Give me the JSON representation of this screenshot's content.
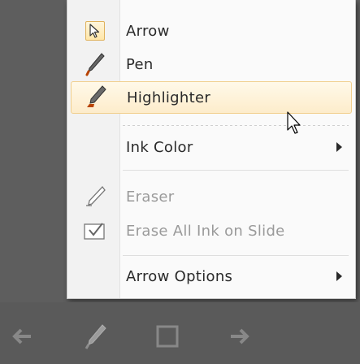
{
  "menu": {
    "items": [
      {
        "label": "Arrow",
        "icon": "arrow-pointer-icon",
        "checked": true,
        "enabled": true
      },
      {
        "label": "Pen",
        "icon": "pen-icon",
        "enabled": true
      },
      {
        "label": "Highlighter",
        "icon": "highlighter-icon",
        "enabled": true,
        "hovered": true
      },
      {
        "label": "Ink Color",
        "enabled": true,
        "submenu": true
      },
      {
        "label": "Eraser",
        "icon": "eraser-icon",
        "enabled": false
      },
      {
        "label": "Erase All Ink on Slide",
        "icon": "erase-all-icon",
        "enabled": false
      },
      {
        "label": "Arrow Options",
        "enabled": true,
        "submenu": true
      }
    ]
  },
  "colors": {
    "highlight_fill": "#fdeccb",
    "highlight_border": "#f1cf8e",
    "disabled_text": "#9a9a9a",
    "backdrop": "#5e5e5e"
  },
  "toolbar": {
    "buttons": [
      "previous-arrow-icon",
      "pen-tool-icon",
      "slide-menu-icon",
      "next-arrow-icon"
    ]
  }
}
